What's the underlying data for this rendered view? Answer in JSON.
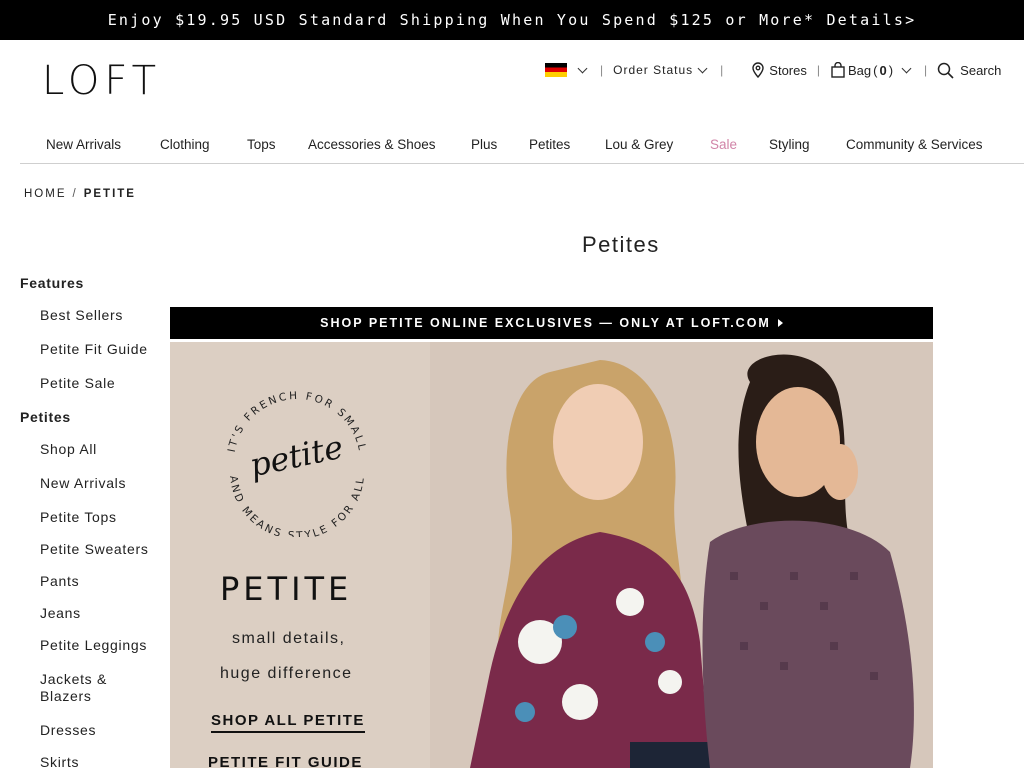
{
  "promo": {
    "text": "Enjoy $19.95 USD Standard Shipping When You Spend $125 or More* Details>"
  },
  "header": {
    "logo": "LOFT",
    "order_status": "Order Status",
    "stores": "Stores",
    "bag_label": "Bag",
    "bag_count": "0",
    "search": "Search"
  },
  "nav": {
    "items": [
      "New Arrivals",
      "Clothing",
      "Tops",
      "Accessories & Shoes",
      "Plus",
      "Petites",
      "Lou & Grey",
      "Sale",
      "Styling",
      "Community & Services"
    ]
  },
  "breadcrumb": {
    "home": "HOME",
    "current": "PETITE"
  },
  "page_title": "Petites",
  "sidebar": {
    "features_heading": "Features",
    "features": [
      "Best Sellers",
      "Petite Fit Guide",
      "Petite Sale"
    ],
    "petites_heading": "Petites",
    "petites": [
      "Shop All",
      "New Arrivals",
      "Petite Tops",
      "Petite Sweaters",
      "Pants",
      "Jeans",
      "Petite Leggings",
      "Jackets & Blazers",
      "Dresses",
      "Skirts"
    ]
  },
  "banner": {
    "exclusive": "SHOP PETITE ONLINE EXCLUSIVES — ONLY AT LOFT.COM",
    "circle_top": "IT'S FRENCH FOR SMALL",
    "circle_bottom": "AND MEANS STYLE FOR ALL",
    "script_word": "petite",
    "headline": "PETITE",
    "sub1": "small details,",
    "sub2": "huge difference",
    "cta1": "SHOP ALL PETITE",
    "cta2": "PETITE FIT GUIDE"
  },
  "colors": {
    "sale": "#d184a8",
    "promo_bg": "#000000",
    "hero_bg": "#d8cbc0"
  }
}
